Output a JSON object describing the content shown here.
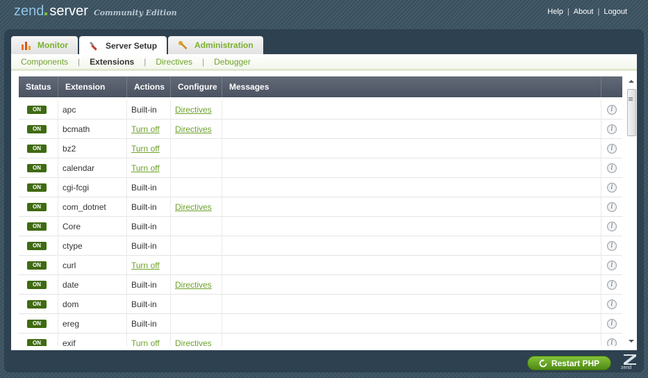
{
  "header": {
    "logo_zend": "zend",
    "logo_server": "server",
    "logo_edition": "Community Edition",
    "links": [
      "Help",
      "About",
      "Logout"
    ],
    "link_separator": "|"
  },
  "tabs": [
    {
      "label": "Monitor",
      "icon": "bar-chart-icon",
      "active": false
    },
    {
      "label": "Server Setup",
      "icon": "wrench-icon",
      "active": true
    },
    {
      "label": "Administration",
      "icon": "key-icon",
      "active": false
    }
  ],
  "subnav": {
    "items": [
      "Components",
      "Extensions",
      "Directives",
      "Debugger"
    ],
    "active": "Extensions",
    "separator": "|"
  },
  "grid": {
    "columns": [
      "Status",
      "Extension",
      "Actions",
      "Configure",
      "Messages"
    ],
    "rows": [
      {
        "status": "ON",
        "extension": "apc",
        "actions": "Built-in",
        "configure": "Directives"
      },
      {
        "status": "ON",
        "extension": "bcmath",
        "actions": "Turn off",
        "configure": "Directives"
      },
      {
        "status": "ON",
        "extension": "bz2",
        "actions": "Turn off",
        "configure": ""
      },
      {
        "status": "ON",
        "extension": "calendar",
        "actions": "Turn off",
        "configure": ""
      },
      {
        "status": "ON",
        "extension": "cgi-fcgi",
        "actions": "Built-in",
        "configure": ""
      },
      {
        "status": "ON",
        "extension": "com_dotnet",
        "actions": "Built-in",
        "configure": "Directives"
      },
      {
        "status": "ON",
        "extension": "Core",
        "actions": "Built-in",
        "configure": ""
      },
      {
        "status": "ON",
        "extension": "ctype",
        "actions": "Built-in",
        "configure": ""
      },
      {
        "status": "ON",
        "extension": "curl",
        "actions": "Turn off",
        "configure": ""
      },
      {
        "status": "ON",
        "extension": "date",
        "actions": "Built-in",
        "configure": "Directives"
      },
      {
        "status": "ON",
        "extension": "dom",
        "actions": "Built-in",
        "configure": ""
      },
      {
        "status": "ON",
        "extension": "ereg",
        "actions": "Built-in",
        "configure": ""
      },
      {
        "status": "ON",
        "extension": "exif",
        "actions": "Turn off",
        "configure": "Directives"
      }
    ]
  },
  "footer": {
    "restart_label": "Restart PHP",
    "brand_label": "zend"
  },
  "colors": {
    "accent_green": "#6ea12a",
    "status_on": "#3f6a12",
    "header_bg": "#3f5564",
    "grid_header": "#555c6b"
  }
}
